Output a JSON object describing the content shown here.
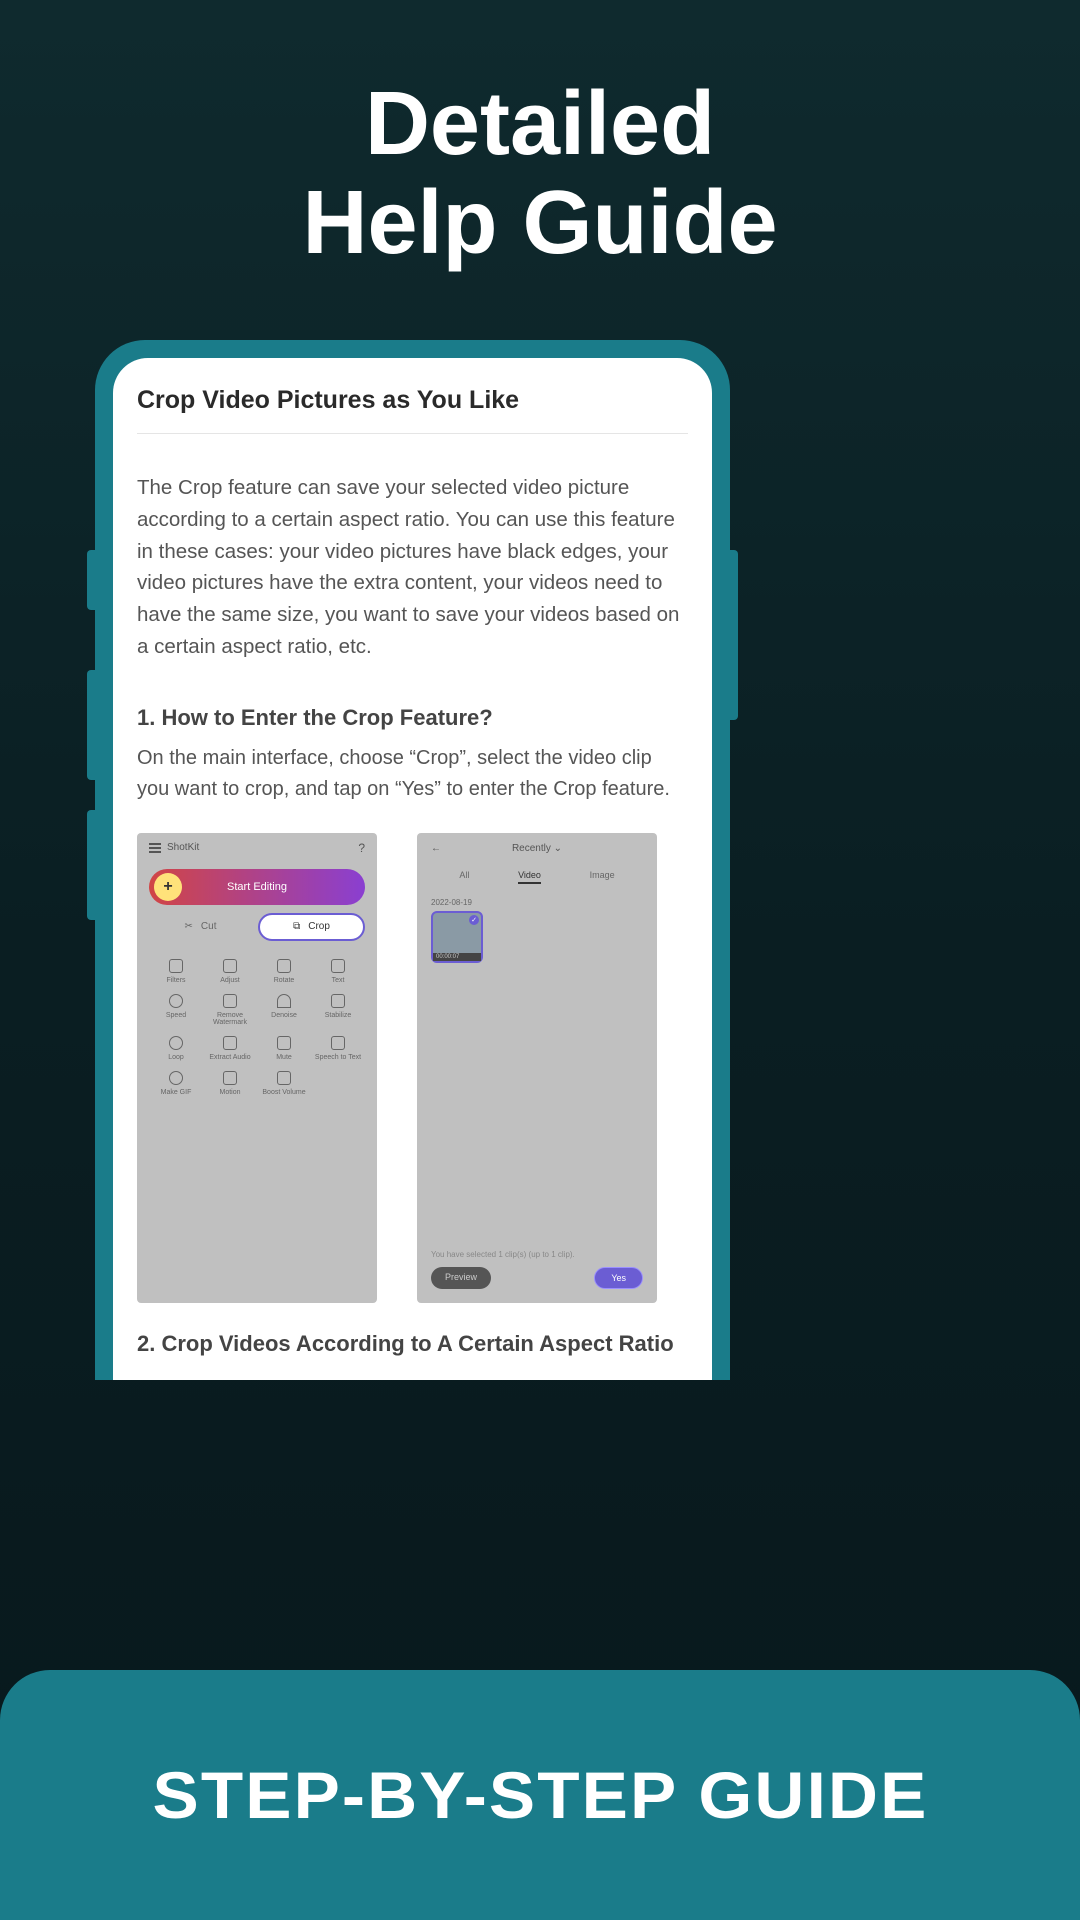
{
  "hero": {
    "line1": "Detailed",
    "line2": "Help Guide"
  },
  "article": {
    "title": "Crop Video Pictures as You Like",
    "intro": "The Crop feature can save your selected video picture according to a certain aspect ratio. You can use this feature in these cases: your video pictures have black edges, your video pictures have the extra content, your videos need to have the same size, you want to save your videos based on a certain aspect ratio, etc.",
    "section1_heading": "1. How to Enter the Crop Feature?",
    "section1_body": "On the main interface, choose “Crop”, select the video clip you want to crop, and tap on “Yes” to enter the Crop feature.",
    "section2_heading": "2. Crop Videos According to A Certain Aspect Ratio"
  },
  "mock_left": {
    "app_name": "ShotKit",
    "start_button": "Start Editing",
    "tabs": {
      "cut": "Cut",
      "crop": "Crop"
    },
    "tools": [
      "Filters",
      "Adjust",
      "Rotate",
      "Text",
      "Speed",
      "Remove Watermark",
      "Denoise",
      "Stabilize",
      "Loop",
      "Extract Audio",
      "Mute",
      "Speech to Text",
      "Make GIF",
      "Motion",
      "Boost Volume"
    ]
  },
  "mock_right": {
    "back": "←",
    "dropdown": "Recently",
    "filter_tabs": {
      "all": "All",
      "video": "Video",
      "image": "Image"
    },
    "date": "2022-08-19",
    "thumb_duration": "00:00:07",
    "selected_text": "You have selected 1 clip(s) (up to 1 clip).",
    "preview": "Preview",
    "yes": "Yes"
  },
  "footer": "STEP-BY-STEP GUIDE"
}
